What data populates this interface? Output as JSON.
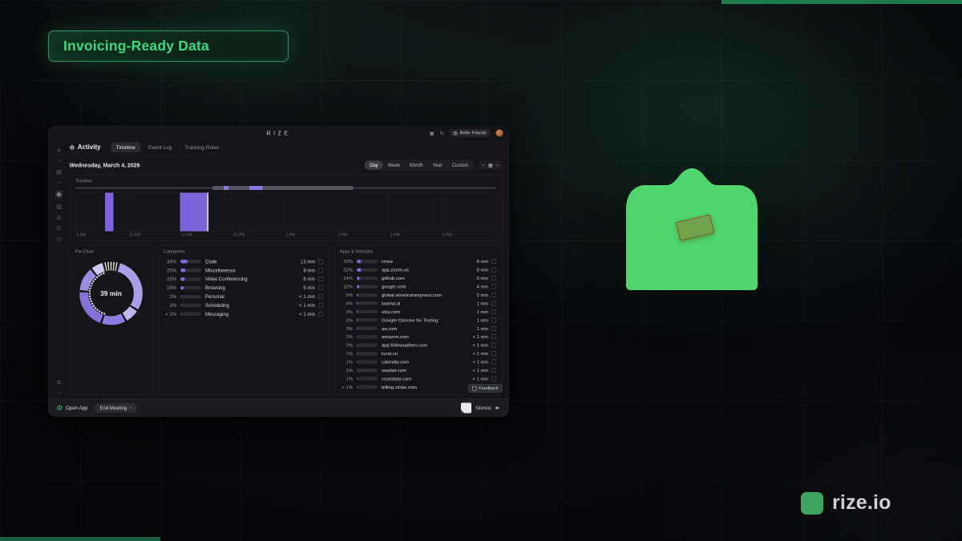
{
  "badge": {
    "label": "Invoicing-Ready Data"
  },
  "brand": {
    "logo_text": "rize.io"
  },
  "colors": {
    "accent_green": "#3ed77f",
    "envelope_green": "#4ed56d",
    "logo_green": "#3da35f",
    "top_bar_green": "#1e7c4b",
    "bottom_bar_green": "#1b5e41",
    "purple_bar": "#7d64da",
    "minimap_purple": "#8d78e0",
    "row_fill_purple": "#7b68d9"
  },
  "app": {
    "titlebar": {
      "title": "RIZE",
      "refer_label": "Refer Friends",
      "icons": [
        {
          "name": "shield-icon",
          "glyph": "▣"
        },
        {
          "name": "history-icon",
          "glyph": "↻"
        }
      ]
    },
    "sidebar": {
      "icons": [
        {
          "name": "logo-icon",
          "glyph": "∗"
        },
        {
          "name": "home-icon",
          "glyph": "⌂"
        },
        {
          "name": "calendar-icon",
          "glyph": "▤"
        },
        {
          "name": "timer-icon",
          "glyph": "◔"
        },
        {
          "name": "globe-icon",
          "glyph": "⊕",
          "active": true
        },
        {
          "name": "journal-icon",
          "glyph": "▥"
        },
        {
          "name": "focus-icon",
          "glyph": "◎"
        },
        {
          "name": "tasks-icon",
          "glyph": "☑"
        },
        {
          "name": "clock-icon",
          "glyph": "◷"
        }
      ],
      "bottom_icons": [
        {
          "name": "settings-icon",
          "glyph": "⚙"
        },
        {
          "name": "help-icon",
          "glyph": "○"
        }
      ]
    },
    "nav": {
      "icon_glyph": "⊕",
      "section_label": "Activity",
      "tabs": [
        "Timeline",
        "Event Log",
        "Tracking Rules"
      ],
      "active_tab": "Timeline"
    },
    "date_row": {
      "date": "Wednesday, March 4, 2026",
      "ranges": [
        "Day",
        "Week",
        "Month",
        "Year",
        "Custom"
      ],
      "active_range": "Day",
      "nav_icons": [
        {
          "name": "chevron-left-icon",
          "glyph": "‹"
        },
        {
          "name": "calendar-icon",
          "glyph": "▦"
        },
        {
          "name": "chevron-right-icon",
          "glyph": "›"
        }
      ]
    },
    "timeline": {
      "label": "Timeline",
      "hours": [
        "9 AM",
        "10 AM",
        "11 AM",
        "12 PM",
        "1 PM",
        "2 PM",
        "3 PM",
        "4 PM"
      ],
      "total_hours": 8.05,
      "bars": [
        {
          "start": 0.57,
          "end": 0.73,
          "cursor": false
        },
        {
          "start": 2.0,
          "end": 2.52,
          "cursor": true
        }
      ],
      "minimap": {
        "viewport": {
          "start": 0.326,
          "width": 0.334
        },
        "marks": [
          {
            "start": 0.352,
            "width": 0.012
          },
          {
            "start": 0.413,
            "width": 0.032
          }
        ]
      }
    },
    "pie": {
      "label": "Pie Chart",
      "center_label": "39 min",
      "segments": [
        {
          "value": 8,
          "color": "#eae7dd",
          "dashed": true
        },
        {
          "value": 30,
          "color": "#ac9ce7"
        },
        {
          "value": 8,
          "color": "#c3b8ed"
        },
        {
          "value": 13,
          "color": "#8f7cdf"
        },
        {
          "value": 21,
          "color": "#8671d8"
        },
        {
          "value": 13,
          "color": "#9d8ce2"
        },
        {
          "value": 7,
          "color": "#cfc7f1"
        }
      ]
    },
    "categories": {
      "label": "Categories",
      "rows": [
        {
          "pct": "34%",
          "fill": 34,
          "name": "Code",
          "time": "13 min"
        },
        {
          "pct": "25%",
          "fill": 25,
          "name": "Miscellaneous",
          "time": "9 min"
        },
        {
          "pct": "22%",
          "fill": 22,
          "name": "Video Conferencing",
          "time": "8 min"
        },
        {
          "pct": "15%",
          "fill": 15,
          "name": "Browsing",
          "time": "5 min"
        },
        {
          "pct": "2%",
          "fill": 2,
          "name": "Personal",
          "time": "< 1 min"
        },
        {
          "pct": "1%",
          "fill": 1,
          "name": "Scheduling",
          "time": "< 1 min"
        },
        {
          "pct": "< 1%",
          "fill": 0.5,
          "name": "Messaging",
          "time": "< 1 min"
        }
      ]
    },
    "apps": {
      "label": "Apps & Websites",
      "rows": [
        {
          "pct": "22%",
          "fill": 22,
          "name": "cmux",
          "time": "8 min"
        },
        {
          "pct": "22%",
          "fill": 22,
          "name": "app.zoom.us",
          "time": "8 min"
        },
        {
          "pct": "14%",
          "fill": 14,
          "name": "github.com",
          "time": "5 min"
        },
        {
          "pct": "12%",
          "fill": 12,
          "name": "google.com",
          "time": "4 min"
        },
        {
          "pct": "5%",
          "fill": 5,
          "name": "global.americanexpress.com",
          "time": "2 min"
        },
        {
          "pct": "4%",
          "fill": 4,
          "name": "lawma.ai",
          "time": "1 min"
        },
        {
          "pct": "3%",
          "fill": 3,
          "name": "etsy.com",
          "time": "1 min"
        },
        {
          "pct": "3%",
          "fill": 3,
          "name": "Google Chrome for Testing",
          "time": "1 min"
        },
        {
          "pct": "3%",
          "fill": 3,
          "name": "aa.com",
          "time": "1 min"
        },
        {
          "pct": "2%",
          "fill": 2,
          "name": "amazon.com",
          "time": "< 1 min"
        },
        {
          "pct": "2%",
          "fill": 2,
          "name": "app.followupthen.com",
          "time": "< 1 min"
        },
        {
          "pct": "1%",
          "fill": 1,
          "name": "lucid.co",
          "time": "< 1 min"
        },
        {
          "pct": "1%",
          "fill": 1,
          "name": "calendly.com",
          "time": "< 1 min"
        },
        {
          "pct": "1%",
          "fill": 1,
          "name": "wayfair.com",
          "time": "< 1 min"
        },
        {
          "pct": "1%",
          "fill": 1,
          "name": "crustdata.com",
          "time": "< 1 min"
        },
        {
          "pct": "< 1%",
          "fill": 0.5,
          "name": "billing.stripe.com",
          "time": ""
        }
      ]
    },
    "feedback_label": "Feedback",
    "footer": {
      "open_label": "Open App",
      "end_meeting_label": "End Meeting",
      "silence_label": "Silence"
    }
  }
}
